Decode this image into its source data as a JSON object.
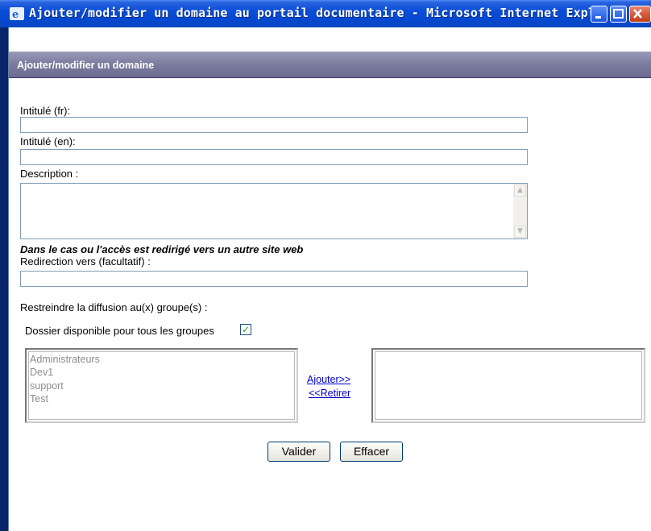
{
  "window": {
    "title": "Ajouter/modifier un domaine au portail documentaire - Microsoft Internet Explo...",
    "icon": "ie-icon"
  },
  "form": {
    "header": "Ajouter/modifier un domaine",
    "label_fr": "Intitulé (fr):",
    "label_en": "Intitulé (en):",
    "label_description": "Description :",
    "note": "Dans le cas ou l'accès est redirigé vers un autre site web",
    "label_redirect": "Redirection vers (facultatif) :",
    "label_restrict": "Restreindre la diffusion au(x) groupe(s) :",
    "label_all_groups": "Dossier disponible pour tous les groupes",
    "all_groups_checked": true,
    "groups_available": [
      "Administrateurs",
      "Dev1",
      "support",
      "Test"
    ],
    "groups_selected": [],
    "add_link": "Ajouter>>",
    "remove_link": "<<Retirer",
    "submit_label": "Valider",
    "reset_label": "Effacer"
  },
  "colors": {
    "title_bar": "#0a4ed8",
    "header_bar": "#7d7da0",
    "link": "#0000cc"
  }
}
